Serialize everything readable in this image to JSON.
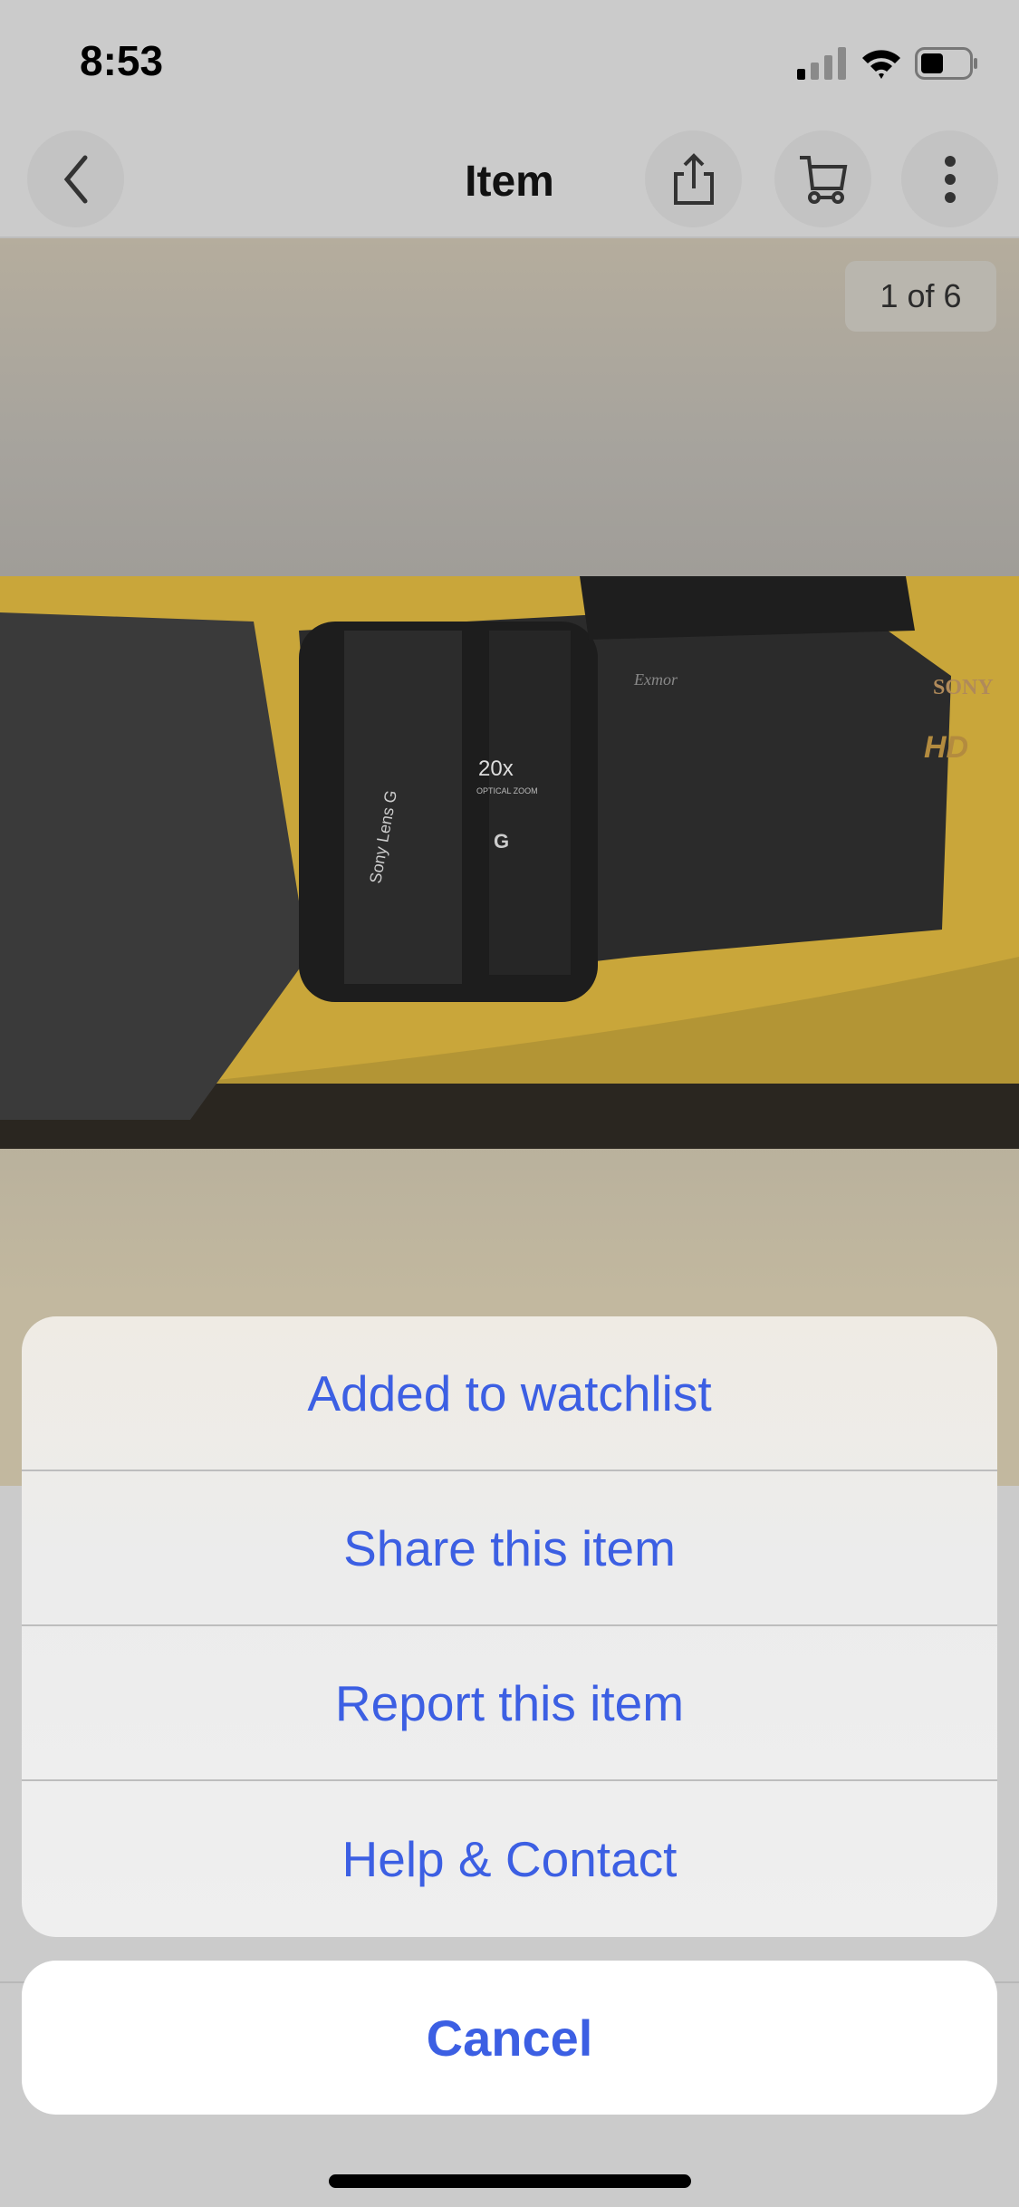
{
  "status_bar": {
    "time": "8:53",
    "icons": [
      "cellular-signal-icon",
      "wifi-icon",
      "battery-icon"
    ]
  },
  "header": {
    "title": "Item",
    "icons": [
      "chevron-left-icon",
      "share-icon",
      "cart-icon",
      "more-vertical-icon"
    ]
  },
  "gallery": {
    "counter": "1 of 6",
    "photo_text": {
      "brand": "SONY",
      "hd": "HD",
      "lens": "Sony Lens G",
      "zoom": "20x",
      "zoom_sub": "OPTICAL ZOOM",
      "exmor": "Exmor",
      "g": "G"
    }
  },
  "action_sheet": {
    "items": [
      {
        "label": "Added to watchlist"
      },
      {
        "label": "Share this item"
      },
      {
        "label": "Report this item"
      },
      {
        "label": "Help & Contact"
      }
    ],
    "cancel": "Cancel"
  },
  "colors": {
    "accent": "#3c5fe3",
    "overlay": "#cbcbcb"
  }
}
